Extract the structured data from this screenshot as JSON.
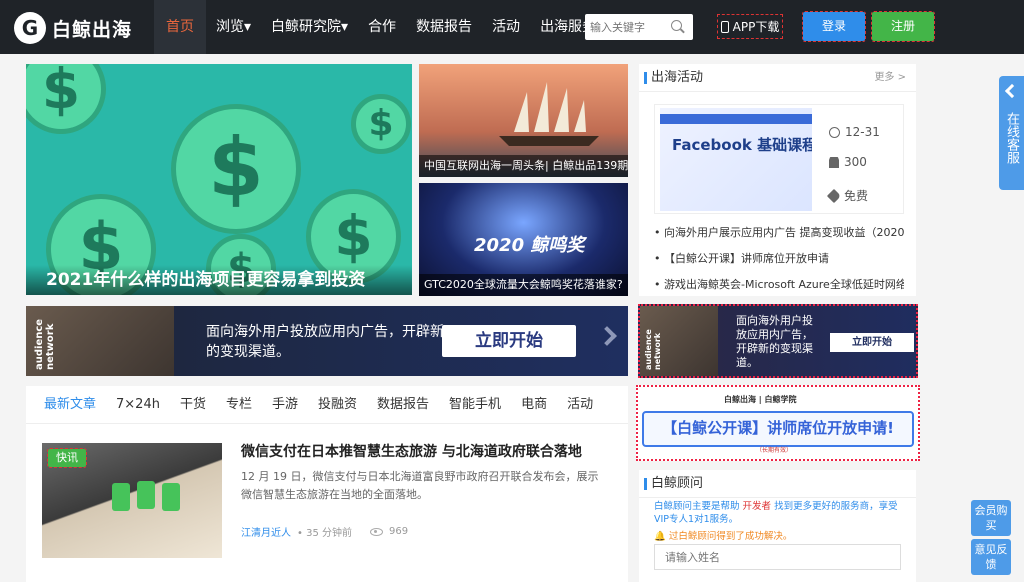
{
  "brand": {
    "logo_letter": "G",
    "name": "白鲸出海"
  },
  "nav": {
    "items": [
      "首页",
      "浏览▾",
      "白鲸研究院▾",
      "合作",
      "数据报告",
      "活动",
      "出海服务▾"
    ],
    "active": "首页"
  },
  "search": {
    "placeholder": "输入关键字",
    "value": ""
  },
  "header": {
    "app_label": "APP下载",
    "login": "登录",
    "register": "注册"
  },
  "hero": {
    "caption": "2021年什么样的出海项目更容易拿到投资",
    "coin_symbol": "$",
    "bg_color": "#2ab8a8",
    "coin_color": "#52d7a4"
  },
  "side_articles": [
    {
      "caption": "中国互联网出海一周头条| 白鲸出品139期"
    },
    {
      "caption": "GTC2020全球流量大会鲸鸣奖花落谁家?",
      "stage_text": "2020 鲸鸣奖"
    }
  ],
  "banner": {
    "brand_vertical": "audience network",
    "text": "面向海外用户投放应用内广告，开辟新的变现渠道。",
    "cta": "立即开始"
  },
  "news": {
    "tabs": [
      "最新文章",
      "7×24h",
      "干货",
      "专栏",
      "手游",
      "投融资",
      "数据报告",
      "智能手机",
      "电商",
      "活动"
    ],
    "active_tab": "最新文章",
    "article": {
      "badge": "快讯",
      "title": "微信支付在日本推智慧生态旅游 与北海道政府联合落地",
      "desc": "12 月 19 日，微信支付与日本北海道富良野市政府召开联合发布会，展示微信智慧生态旅游在当地的全面落地。",
      "author": "江清月近人",
      "time": "• 35 分钟前",
      "views": "969"
    }
  },
  "activity": {
    "title": "出海活动",
    "more": "更多 >",
    "event": {
      "image_title": "Facebook 基础课程",
      "date": "12-31",
      "count": "300",
      "price": "免费"
    },
    "list": [
      "• 向海外用户展示应用内广告 提高变现收益（2020",
      "• 【白鲸公开课】讲师席位开放申请",
      "• 游戏出海鲸英会-Microsoft Azure全球低延时网络"
    ]
  },
  "ad_small": {
    "brand_vertical": "audience network",
    "text": "面向海外用户投放应用内广告，开辟新的变现渠道。",
    "cta": "立即开始"
  },
  "ad_course": {
    "logo": "白鲸出海 | 白鲸学院",
    "text": "【白鲸公开课】讲师席位开放申请!",
    "sub": "（长期有效）"
  },
  "advisor": {
    "title": "白鲸顾问",
    "desc_prefix": "白鲸顾问主要是帮助",
    "desc_highlight": "开发者",
    "desc_suffix": "找到更多更好的服务商，享受VIP专人1对1服务。",
    "note": "🔔 过白鲸顾问得到了成功解决。",
    "input_placeholder": "请输入姓名"
  },
  "float": {
    "service": "在线客服",
    "member": "会员购买",
    "feedback": "意见反馈"
  }
}
